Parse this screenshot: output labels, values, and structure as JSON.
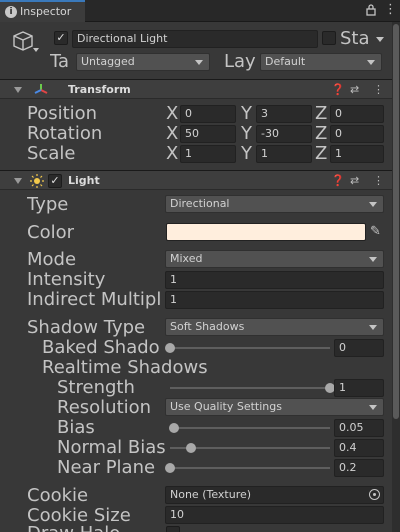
{
  "tab": {
    "title": "Inspector",
    "lock_icon": "lock-icon",
    "menu_icon": "kebab-icon"
  },
  "object": {
    "active": true,
    "name": "Directional Light",
    "static_label": "Sta",
    "tag_label": "Ta",
    "tag_value": "Untagged",
    "layer_label": "Lay",
    "layer_value": "Default"
  },
  "transform": {
    "title": "Transform",
    "position_label": "Position",
    "rotation_label": "Rotation",
    "scale_label": "Scale",
    "axis_x": "X",
    "axis_y": "Y",
    "axis_z": "Z",
    "position": {
      "x": "0",
      "y": "3",
      "z": "0"
    },
    "rotation": {
      "x": "50",
      "y": "-30",
      "z": "0"
    },
    "scale": {
      "x": "1",
      "y": "1",
      "z": "1"
    }
  },
  "light": {
    "title": "Light",
    "enabled": true,
    "type_label": "Type",
    "type_value": "Directional",
    "color_label": "Color",
    "color_value": "#ffeedd",
    "mode_label": "Mode",
    "mode_value": "Mixed",
    "intensity_label": "Intensity",
    "intensity_value": "1",
    "indirect_label": "Indirect Multipl",
    "indirect_value": "1",
    "shadow_type_label": "Shadow Type",
    "shadow_type_value": "Soft Shadows",
    "baked_label": "Baked Shado",
    "baked_value": "0",
    "realtime_label": "Realtime Shadows",
    "strength_label": "Strength",
    "strength_value": "1",
    "resolution_label": "Resolution",
    "resolution_value": "Use Quality Settings",
    "bias_label": "Bias",
    "bias_value": "0.05",
    "normal_bias_label": "Normal Bias",
    "normal_bias_value": "0.4",
    "near_plane_label": "Near Plane",
    "near_plane_value": "0.2",
    "cookie_label": "Cookie",
    "cookie_value": "None (Texture)",
    "cookie_size_label": "Cookie Size",
    "cookie_size_value": "10",
    "draw_halo_label": "Draw Halo"
  },
  "sliders": {
    "baked": 0.0,
    "strength": 1.0,
    "bias": 0.025,
    "normal_bias": 0.133,
    "near_plane": 0.0
  }
}
